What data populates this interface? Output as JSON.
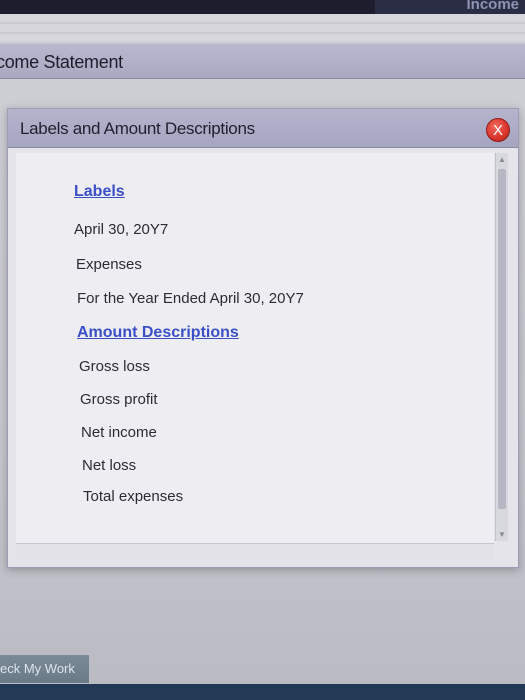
{
  "statement": {
    "title": "come Statement"
  },
  "modal": {
    "title": "Labels and Amount Descriptions",
    "close_label": "X",
    "items": [
      {
        "text": "Labels",
        "kind": "link"
      },
      {
        "text": "April 30, 20Y7",
        "kind": "item"
      },
      {
        "text": "Expenses",
        "kind": "item"
      },
      {
        "text": "For the Year Ended April 30, 20Y7",
        "kind": "item"
      },
      {
        "text": "Amount Descriptions",
        "kind": "link"
      },
      {
        "text": "Gross loss",
        "kind": "item"
      },
      {
        "text": "Gross profit",
        "kind": "item"
      },
      {
        "text": "Net income",
        "kind": "item"
      },
      {
        "text": "Net loss",
        "kind": "item"
      },
      {
        "text": "Total expenses",
        "kind": "item"
      }
    ]
  },
  "footer": {
    "check_button": "eck My Work"
  },
  "top_tab": {
    "text": "Income"
  },
  "colors": {
    "link": "#3a4fc8",
    "close": "#d9342a"
  }
}
